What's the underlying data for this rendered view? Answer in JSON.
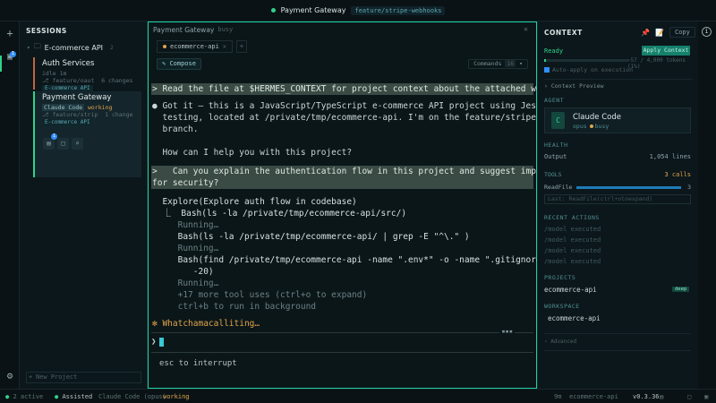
{
  "topbar": {
    "title": "Payment Gateway",
    "branch": "feature/stripe-webhooks"
  },
  "sessions": {
    "title": "SESSIONS",
    "project": {
      "name": "E-commerce API",
      "count": "2"
    },
    "items": [
      {
        "name": "Auth Services",
        "status": "idle",
        "status_extra": "1m",
        "branch": "feature/oaut",
        "changes": "6 changes",
        "workspace": "E-commerce API"
      },
      {
        "name": "Payment Gateway",
        "agent": "Claude Code",
        "status": "working",
        "branch": "feature/strip",
        "changes": "1 change",
        "workspace": "E-commerce API",
        "badge": "1"
      }
    ],
    "new_project": "New Project"
  },
  "terminal": {
    "title": "Payment Gateway",
    "state": "busy",
    "tab": "ecommerce-api",
    "compose": "Compose",
    "commands": "Commands",
    "commands_count": "16",
    "lines": {
      "user1": "> Read the file at $HERMES_CONTEXT for project context about the attached workspaces.",
      "resp1a": "● Got it — this is a JavaScript/TypeScript e-commerce API project using Jest for",
      "resp1b": "  testing, located at /private/tmp/ecommerce-api. I'm on the feature/stripe-webhooks",
      "resp1c": "  branch.",
      "resp2": "  How can I help you with this project?",
      "user2a": ">   Can you explain the authentication flow in this project and suggest improvements",
      "user2b": "for security?",
      "explore": "  Explore(Explore auth flow in codebase)",
      "bash1": "  ⎿  Bash(ls -la /private/tmp/ecommerce-api/src/)",
      "run1": "     Running…",
      "bash2": "     Bash(ls -la /private/tmp/ecommerce-api/ | grep -E \"^\\.\" )",
      "run2": "     Running…",
      "bash3a": "     Bash(find /private/tmp/ecommerce-api -name \".env*\" -o -name \".gitignore\" | head",
      "bash3b": "        -20)",
      "run3": "     Running…",
      "more": "     +17 more tool uses (ctrl+o to expand)",
      "bg": "     ctrl+b to run in background",
      "spinner": "✻ Whatchamacalliting…"
    },
    "input_indicator": "▪▪▪",
    "prompt": "❯",
    "interrupt": "esc to interrupt"
  },
  "context": {
    "title": "CONTEXT",
    "copy": "Copy",
    "ready": "Ready",
    "apply": "Apply Context",
    "tokens": "~57 / 4,000 tokens (1%)",
    "token_fraction": 0.01,
    "auto_apply": "Auto-apply on execution",
    "preview": "› Context Preview",
    "agent_label": "AGENT",
    "agent": {
      "icon": "C",
      "name": "Claude Code",
      "model": "opus",
      "state": "busy"
    },
    "health_label": "HEALTH",
    "output_label": "Output",
    "output_value": "1,054 lines",
    "tools_label": "TOOLS",
    "tools_calls": "3 calls",
    "readfile": "ReadFile",
    "readfile_count": "3",
    "last": "Last: ReadFile(ctrl+otoexpand)",
    "recent_label": "RECENT ACTIONS",
    "recent": [
      "/model executed",
      "/model executed",
      "/model executed",
      "/model executed"
    ],
    "projects_label": "PROJECTS",
    "project": "ecommerce-api",
    "project_tag": "deep",
    "workspace_label": "WORKSPACE",
    "workspace": "ecommerce-api",
    "advanced": "› Advanced"
  },
  "statusbar": {
    "active": "2 active",
    "assisted": "Assisted",
    "agent": "Claude Code (opus)",
    "state": "working",
    "time": "9m",
    "project": "ecommerce-api",
    "version": "v0.3.36"
  }
}
